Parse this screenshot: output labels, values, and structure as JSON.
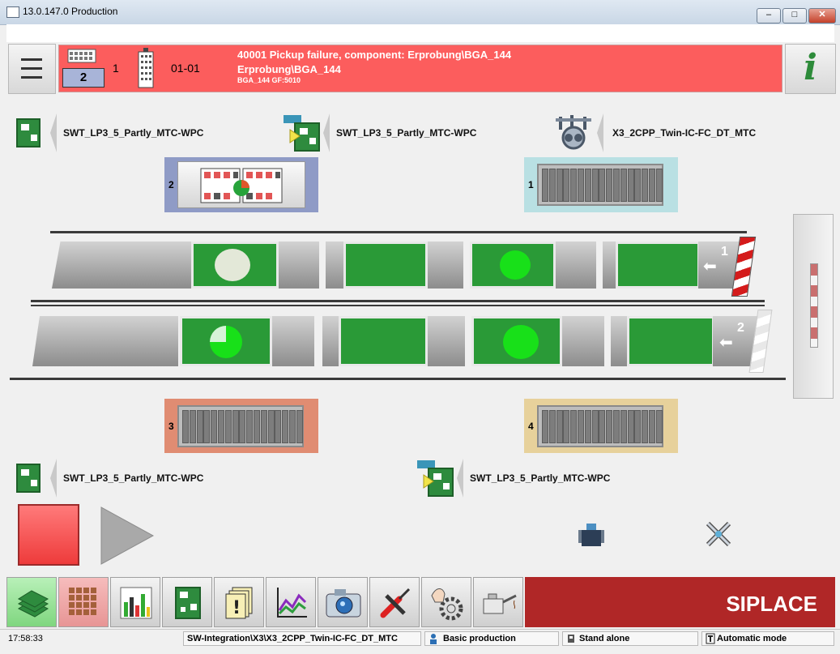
{
  "window": {
    "title": "13.0.147.0 Production",
    "minimize": "–",
    "maximize": "□",
    "close": "✕"
  },
  "header": {
    "menu_icon": "hamburger-icon",
    "machine_count": "2",
    "line_number": "1",
    "station_id": "01-01",
    "alarm": {
      "line1": "40001 Pickup failure, component: Erprobung\\BGA_144",
      "line2": "Erprobung\\BGA_144",
      "line3": "BGA_144 GF:5010",
      "color": "#fc5d5d"
    },
    "info_label": "i"
  },
  "programs": {
    "top_left": "SWT_LP3_5_Partly_MTC-WPC",
    "top_center": "SWT_LP3_5_Partly_MTC-WPC",
    "top_right": "X3_2CPP_Twin-IC-FC_DT_MTC",
    "bottom_left": "SWT_LP3_5_Partly_MTC-WPC",
    "bottom_center": "SWT_LP3_5_Partly_MTC-WPC"
  },
  "trays": {
    "t1": "1",
    "t2": "2",
    "t3": "3",
    "t4": "4"
  },
  "lanes": {
    "lane1": "1",
    "lane2": "2"
  },
  "toolbar": {
    "brand": "SIPLACE"
  },
  "status": {
    "time": "17:58:33",
    "path": "SW-Integration\\X3\\X3_2CPP_Twin-IC-FC_DT_MTC",
    "user_mode": "Basic production",
    "line_mode": "Stand alone",
    "run_mode": "Automatic mode"
  },
  "colors": {
    "accent_green": "#2e8b3e",
    "alarm_red": "#fc5d5d",
    "brand_red": "#b02727",
    "stop_red": "#ff5a5a"
  }
}
